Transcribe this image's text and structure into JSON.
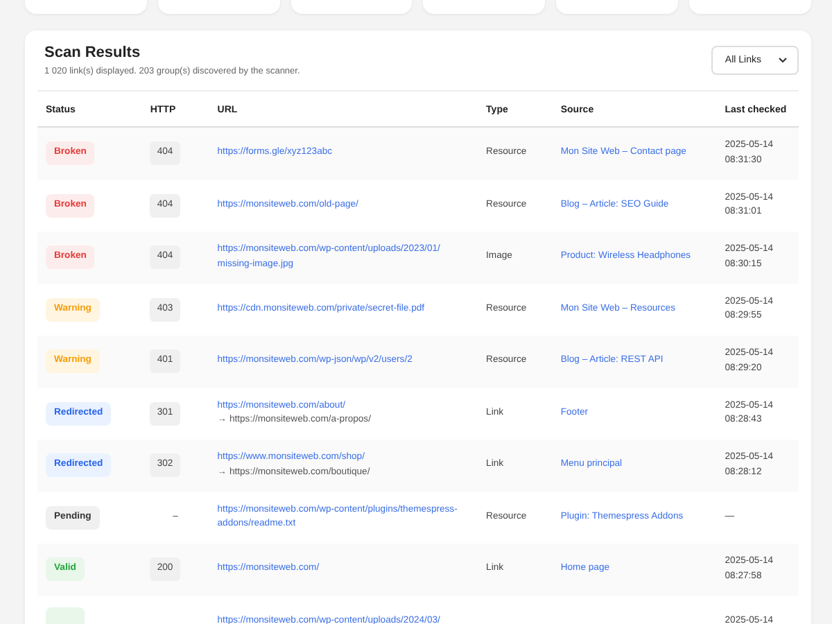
{
  "scan_results": {
    "title": "Scan Results",
    "subtitle": "1 020 link(s) displayed. 203 group(s) discovered by the scanner.",
    "filter": {
      "value": "All Links"
    },
    "columns": [
      "Status",
      "HTTP",
      "URL",
      "Type",
      "Source",
      "Last checked"
    ],
    "rows": [
      {
        "status": {
          "kind": "broken",
          "label": "Broken"
        },
        "http": "404",
        "url": "https://forms.gle/xyz123abc",
        "type": "Resource",
        "source": "Mon Site Web – Contact page",
        "date": "2025-05-14",
        "time": "08:31:30"
      },
      {
        "status": {
          "kind": "broken",
          "label": "Broken"
        },
        "http": "404",
        "url": "https://monsiteweb.com/old-page/",
        "type": "Resource",
        "source": "Blog – Article: SEO Guide",
        "date": "2025-05-14",
        "time": "08:31:01"
      },
      {
        "status": {
          "kind": "broken",
          "label": "Broken"
        },
        "http": "404",
        "url": "https://monsiteweb.com/wp-content/uploads/2023/01/missing-image.jpg",
        "type": "Image",
        "source": "Product: Wireless Headphones",
        "date": "2025-05-14",
        "time": "08:30:15"
      },
      {
        "status": {
          "kind": "warning",
          "label": "Warning"
        },
        "http": "403",
        "url": "https://cdn.monsiteweb.com/private/secret-file.pdf",
        "type": "Resource",
        "source": "Mon Site Web – Resources",
        "date": "2025-05-14",
        "time": "08:29:55"
      },
      {
        "status": {
          "kind": "warning",
          "label": "Warning"
        },
        "http": "401",
        "url": "https://monsiteweb.com/wp-json/wp/v2/users/2",
        "type": "Resource",
        "source": "Blog – Article: REST API",
        "date": "2025-05-14",
        "time": "08:29:20"
      },
      {
        "status": {
          "kind": "redirected",
          "label": "Redirected"
        },
        "http": "301",
        "url": "https://monsiteweb.com/about/",
        "redirect": "→  https://monsiteweb.com/a-propos/",
        "type": "Link",
        "source": "Footer",
        "date": "2025-05-14",
        "time": "08:28:43"
      },
      {
        "status": {
          "kind": "redirected",
          "label": "Redirected"
        },
        "http": "302",
        "url": "https://www.monsiteweb.com/shop/",
        "redirect": "→  https://monsiteweb.com/boutique/",
        "type": "Link",
        "source": "Menu principal",
        "date": "2025-05-14",
        "time": "08:28:12"
      },
      {
        "status": {
          "kind": "pending",
          "label": "Pending"
        },
        "http": "–",
        "url": "https://monsiteweb.com/wp-content/plugins/themespress-addons/readme.txt",
        "type": "Resource",
        "source": "Plugin: Themespress Addons",
        "date": "—"
      },
      {
        "status": {
          "kind": "valid",
          "label": "Valid"
        },
        "http": "200",
        "url": "https://monsiteweb.com/",
        "type": "Link",
        "source": "Home page",
        "date": "2025-05-14",
        "time": "08:27:58"
      },
      {
        "status": {
          "kind": "valid"
        },
        "url": "https://monsiteweb.com/wp-content/uploads/2024/03/",
        "date": "2025-05-14"
      }
    ]
  }
}
